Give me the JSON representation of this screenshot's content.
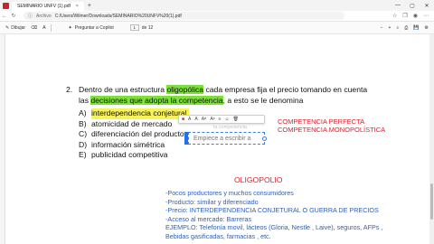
{
  "titlebar": {
    "tab_title": "SEMINARIO UNFV (1).pdf",
    "close": "×",
    "new_tab": "+",
    "minimize": "—",
    "maximize": "▢",
    "close_window": "✕"
  },
  "address": {
    "label": "Archivo",
    "path": "C:/Users/Wilmer/Downloads/SEMINARIO%20UNFV%20(1).pdf"
  },
  "toolbar": {
    "draw": "Dibujar",
    "copilot": "Preguntar a Copilot",
    "page": "1",
    "page_of": "de 12"
  },
  "question": {
    "number": "2.",
    "pre": "Dentro de una estructura ",
    "hl1": "oligopólica",
    "mid": " cada empresa fija el precio tomando en cuenta las ",
    "hl2": "decisiones que adopta la competencia",
    "post": ", a esto se le denomina"
  },
  "options": [
    {
      "key": "A)",
      "text": "interdependencia conjetural"
    },
    {
      "key": "B)",
      "text": "atomicidad de mercado"
    },
    {
      "key": "C)",
      "text": "diferenciación del producto"
    },
    {
      "key": "D)",
      "text": "información simétrica"
    },
    {
      "key": "E)",
      "text": "publicidad competitiva"
    }
  ],
  "popup_tools": [
    "A",
    "A",
    "Aᴬ",
    "Aᵃ",
    "≡",
    "☺"
  ],
  "editbox": {
    "placeholder": "Empiece a escribir a"
  },
  "faint_text": "la competencia",
  "competencia": [
    "COMPETENCIA PERFECTA",
    "COMPETENCIA MONOPOLÍSTICA"
  ],
  "oligopolio_title": "OLIGOPOLIO",
  "oligopolio_items": [
    "-Pocos productores y muchos consumidores",
    "-Producto: similar y diferenciado",
    "-Precio: INTERDEPENDENCIA CONJETURAL O GUERRA DE PRECIOS",
    "-Acceso al mercado: Barreras",
    "EJEMPLO: Telefonía movil, lácteos (Gloria, Nestle , Laive), seguros, AFPs ,",
    "Bebidas gasificadas, farmacias , etc."
  ],
  "colors": {
    "highlight_green": "#7ee03a",
    "highlight_yellow": "#f7f35a",
    "red": "#e0202c",
    "blue_text": "#2f5fb5"
  }
}
